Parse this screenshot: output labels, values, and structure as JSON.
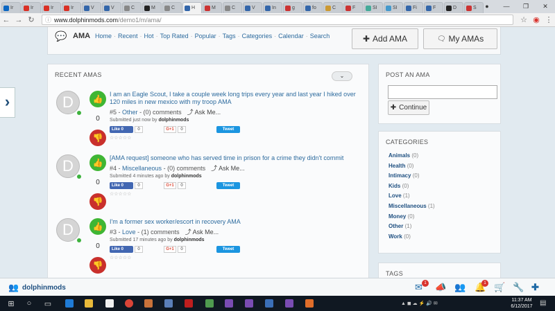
{
  "browser": {
    "tabs": [
      {
        "label": "Ir",
        "color": "#0a66c2"
      },
      {
        "label": "Ir",
        "color": "#d93025"
      },
      {
        "label": "Ir",
        "color": "#d93025"
      },
      {
        "label": "Ir",
        "color": "#d93025"
      },
      {
        "label": "V",
        "color": "#36a"
      },
      {
        "label": "V",
        "color": "#36a"
      },
      {
        "label": "C",
        "color": "#888"
      },
      {
        "label": "M",
        "color": "#222"
      },
      {
        "label": "C",
        "color": "#888"
      },
      {
        "label": "H",
        "color": "#36a"
      },
      {
        "label": "M",
        "color": "#c33"
      },
      {
        "label": "C",
        "color": "#888"
      },
      {
        "label": "V",
        "color": "#36a"
      },
      {
        "label": "In",
        "color": "#36a"
      },
      {
        "label": "g",
        "color": "#c33"
      },
      {
        "label": "fo",
        "color": "#36a"
      },
      {
        "label": "C",
        "color": "#c93"
      },
      {
        "label": "F",
        "color": "#c33"
      },
      {
        "label": "SI",
        "color": "#4a9"
      },
      {
        "label": "SI",
        "color": "#49c"
      },
      {
        "label": "Fi",
        "color": "#36a"
      },
      {
        "label": "F",
        "color": "#36a"
      },
      {
        "label": "D",
        "color": "#222"
      },
      {
        "label": "S",
        "color": "#c33"
      }
    ],
    "active_tab": 9,
    "url_host": "www.dolphinmods.com",
    "url_path": "/demo1/m/ama/"
  },
  "header": {
    "brand": "AMA",
    "menu": [
      "Home",
      "Recent",
      "Hot",
      "Top Rated",
      "Popular",
      "Tags",
      "Categories",
      "Calendar",
      "Search"
    ],
    "add_button": "Add AMA",
    "my_button": "My AMAs"
  },
  "recent": {
    "title": "RECENT AMAS",
    "items": [
      {
        "avatar": "D",
        "votes": "0",
        "question": "I am an Eagle Scout, I take a couple week long trips every year and last year I hiked over 120 miles in new mexico with my troop AMA",
        "number": "#5 -",
        "category": "Other",
        "comments": "- (0) comments",
        "ask": "Ask Me...",
        "submitted": "Submitted just now by",
        "author": "dolphinmods",
        "fb_like": "Like 0",
        "fb_count": "0",
        "gplus": "G+1",
        "gplus_count": "0",
        "tweet": "Tweet"
      },
      {
        "avatar": "D",
        "votes": "0",
        "question": "[AMA request] someone who has served time in prison for a crime they didn't commit",
        "number": "#4 -",
        "category": "Miscellaneous",
        "comments": "- (0) comments",
        "ask": "Ask Me...",
        "submitted": "Submitted 4 minutes ago by",
        "author": "dolphinmods",
        "fb_like": "Like 0",
        "fb_count": "0",
        "gplus": "G+1",
        "gplus_count": "0",
        "tweet": "Tweet"
      },
      {
        "avatar": "D",
        "votes": "0",
        "question": "I'm a former sex worker/escort in recovery AMA",
        "number": "#3 -",
        "category": "Love",
        "comments": "- (1) comments",
        "ask": "Ask Me...",
        "submitted": "Submitted 17 minutes ago by",
        "author": "dolphinmods",
        "fb_like": "Like 0",
        "fb_count": "0",
        "gplus": "G+1",
        "gplus_count": "0",
        "tweet": "Tweet"
      }
    ]
  },
  "post": {
    "title": "POST AN AMA",
    "continue": "Continue"
  },
  "categories": {
    "title": "CATEGORIES",
    "items": [
      {
        "name": "Animals",
        "count": "(0)"
      },
      {
        "name": "Health",
        "count": "(0)"
      },
      {
        "name": "Intimacy",
        "count": "(0)"
      },
      {
        "name": "Kids",
        "count": "(0)"
      },
      {
        "name": "Love",
        "count": "(1)"
      },
      {
        "name": "Miscellaneous",
        "count": "(1)"
      },
      {
        "name": "Money",
        "count": "(0)"
      },
      {
        "name": "Other",
        "count": "(1)"
      },
      {
        "name": "Work",
        "count": "(0)"
      }
    ]
  },
  "tags": {
    "title": "TAGS"
  },
  "bottom_bar": {
    "username": "dolphinmods",
    "mail_badge": "1",
    "notify_badge": "1"
  },
  "taskbar": {
    "time": "11:37 AM",
    "date": "6/12/2017"
  },
  "colors": {
    "accent": "#2d6b9e",
    "up": "#3fb634",
    "down": "#c9302c",
    "taskbar": "#101822"
  }
}
